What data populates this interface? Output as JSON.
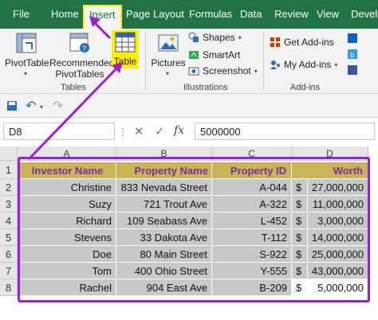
{
  "tabs": [
    "File",
    "Home",
    "Insert",
    "Page Layout",
    "Formulas",
    "Data",
    "Review",
    "View",
    "Develc"
  ],
  "active_tab": "Insert",
  "ribbon": {
    "pivot_table": "PivotTable",
    "recommended_line1": "Recommended",
    "recommended_line2": "PivotTables",
    "table": "Table",
    "tables_group": "Tables",
    "pictures": "Pictures",
    "shapes": "Shapes",
    "smartart": "SmartArt",
    "screenshot": "Screenshot",
    "illustrations_group": "Illustrations",
    "get_addins": "Get Add-ins",
    "my_addins": "My Add-ins",
    "addins_group": "Add-ins"
  },
  "formula_bar": {
    "name_box": "D8",
    "fx": "fx",
    "value": "5000000"
  },
  "columns": [
    "A",
    "B",
    "C",
    "D"
  ],
  "rows": [
    "1",
    "2",
    "3",
    "4",
    "5",
    "6",
    "7",
    "8"
  ],
  "table": {
    "headers": [
      "Investor Name",
      "Property Name",
      "Property ID",
      "Worth"
    ],
    "data": [
      [
        "Christine",
        "833 Nevada Street",
        "A-044",
        "$",
        "27,000,000"
      ],
      [
        "Suzy",
        "721 Trout Ave",
        "A-322",
        "$",
        "11,000,000"
      ],
      [
        "Richard",
        "109 Seabass Ave",
        "L-452",
        "$",
        "3,000,000"
      ],
      [
        "Stevens",
        "33 Dakota Ave",
        "T-112",
        "$",
        "14,000,000"
      ],
      [
        "Doe",
        "80 Main Street",
        "S-922",
        "$",
        "25,000,000"
      ],
      [
        "Tom",
        "400 Ohio Street",
        "Y-555",
        "$",
        "43,000,000"
      ],
      [
        "Rachel",
        "904 East Ave",
        "B-209",
        "$",
        "5,000,000"
      ]
    ]
  },
  "colors": {
    "ribbon_green": "#217346",
    "highlight_yellow": "#ffee00",
    "annotation_purple": "#9b1fd8",
    "header_fill": "#c9b458",
    "data_fill": "#c8c8c8"
  }
}
